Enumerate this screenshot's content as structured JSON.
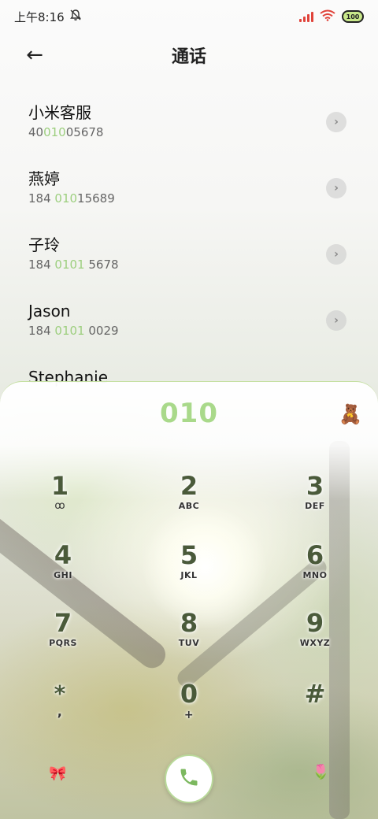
{
  "status_bar": {
    "time": "上午8:16",
    "mute_icon": "bell-slash-icon",
    "battery": "100"
  },
  "header": {
    "title": "通话",
    "back_icon": "←"
  },
  "contacts": [
    {
      "name": "小米客服",
      "number_pre": "40",
      "number_hl": "010",
      "number_post": "05678"
    },
    {
      "name": "燕婷",
      "number_pre": "184 ",
      "number_hl": "010",
      "number_post": "15689"
    },
    {
      "name": "子玲",
      "number_pre": "184 ",
      "number_hl": "0101",
      "number_post": " 5678"
    },
    {
      "name": "Jason",
      "number_pre": "184 ",
      "number_hl": "0101",
      "number_post": " 0029"
    },
    {
      "name": "Stephanie"
    }
  ],
  "dialpad": {
    "display": "010",
    "theme_icon": "🧸",
    "keys": [
      {
        "digit": "1",
        "letters": "ꝏ"
      },
      {
        "digit": "2",
        "letters": "ABC"
      },
      {
        "digit": "3",
        "letters": "DEF"
      },
      {
        "digit": "4",
        "letters": "GHI"
      },
      {
        "digit": "5",
        "letters": "JKL"
      },
      {
        "digit": "6",
        "letters": "MNO"
      },
      {
        "digit": "7",
        "letters": "PQRS"
      },
      {
        "digit": "8",
        "letters": "TUV"
      },
      {
        "digit": "9",
        "letters": "WXYZ"
      },
      {
        "digit": "*",
        "letters": ","
      },
      {
        "digit": "0",
        "letters": "+"
      },
      {
        "digit": "#",
        "letters": ""
      }
    ],
    "left_deco": "🎀",
    "right_deco": "🌷"
  },
  "colors": {
    "accent_green": "#a9d98a",
    "highlight_green": "#9dcf7f"
  }
}
